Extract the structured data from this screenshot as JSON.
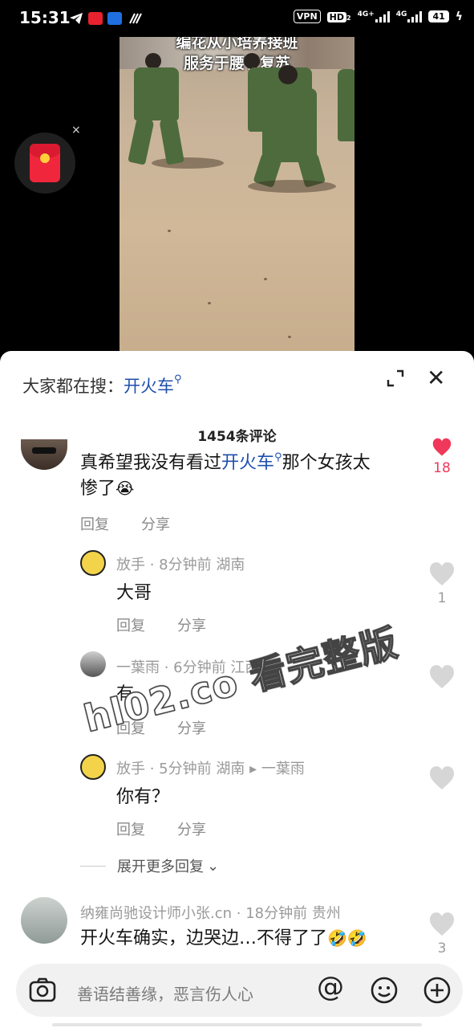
{
  "status_bar": {
    "time": "15:31",
    "vpn": "VPN",
    "hd": "HD",
    "hd_sub": "2",
    "net1": "4G+",
    "net2": "4G",
    "battery": "41"
  },
  "video": {
    "caption_top": "编花从小培养接班",
    "caption_bottom": "服务于腰子复苏"
  },
  "red_packet": {
    "close": "×"
  },
  "sheet": {
    "search_prefix": "大家都在搜：",
    "search_term": "开火车",
    "comment_count": "1454条评论"
  },
  "comments": [
    {
      "text_before": "真希望我没有看过",
      "link": "开火车",
      "text_after_line1": "那个女孩太",
      "text_line2": "惨了",
      "emoji": "😭",
      "reply_label": "回复",
      "share_label": "分享",
      "likes": "18",
      "liked": true
    }
  ],
  "replies": [
    {
      "user": "放手",
      "meta": "· 8分钟前 湖南",
      "text": "大哥",
      "reply_label": "回复",
      "share_label": "分享",
      "likes": "1"
    },
    {
      "user": "一葉雨",
      "meta": "· 6分钟前 江西",
      "text": "有",
      "reply_label": "回复",
      "share_label": "分享",
      "likes": ""
    },
    {
      "user": "放手",
      "meta": "· 5分钟前 湖南 ▸ 一葉雨",
      "text": "你有？",
      "reply_label": "回复",
      "share_label": "分享",
      "likes": ""
    }
  ],
  "expand_more": "展开更多回复",
  "next_comment": {
    "user": "纳雍尚驰设计师小张.cn",
    "meta": "· 18分钟前 贵州",
    "text": "开火车确实，边哭边…不得了了",
    "emoji": "🤣🤣",
    "likes": "3"
  },
  "watermark": "hl02.co 看完整版",
  "input": {
    "placeholder": "善语结善缘，恶言伤人心",
    "at": "@"
  }
}
